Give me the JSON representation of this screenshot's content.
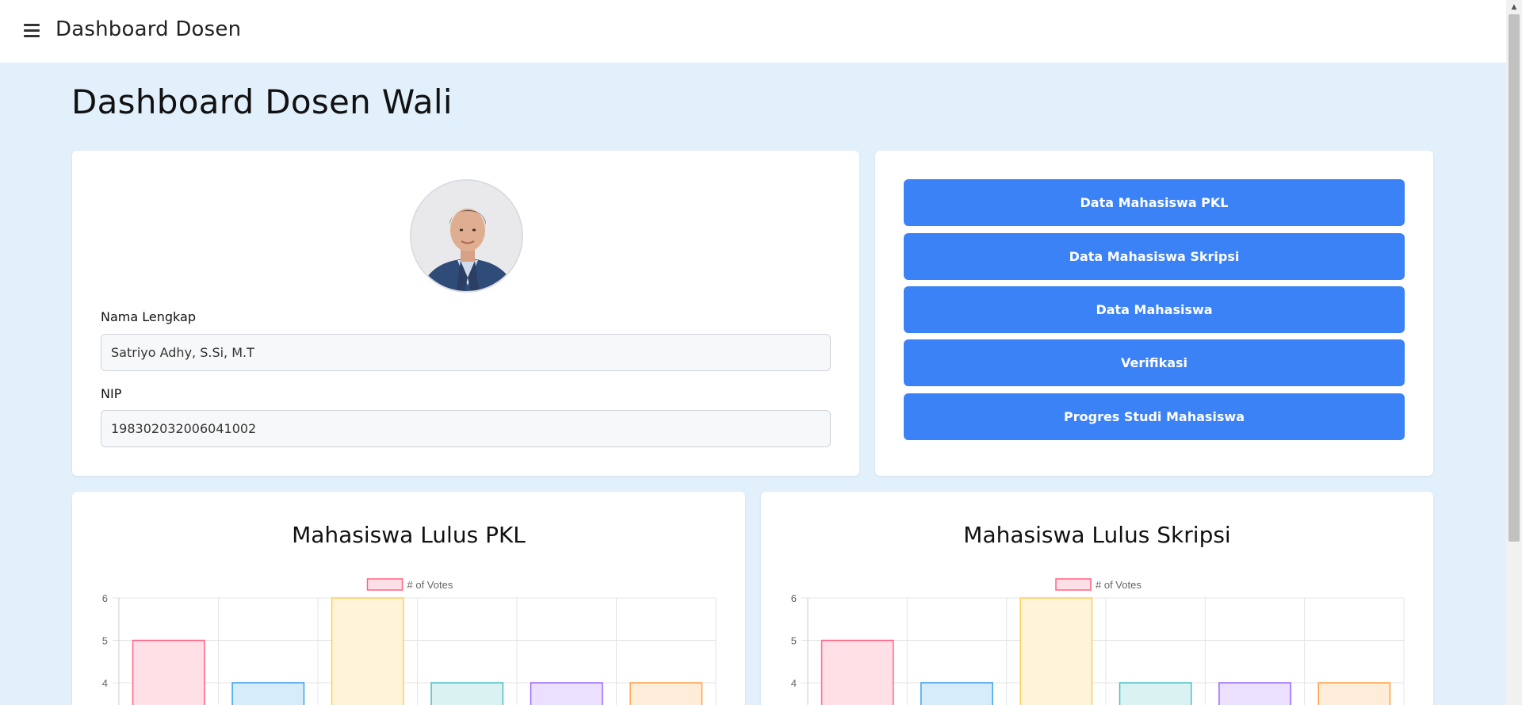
{
  "header": {
    "title": "Dashboard Dosen",
    "menu_icon": "hamburger-icon"
  },
  "page": {
    "title": "Dashboard Dosen Wali"
  },
  "profile": {
    "name_label": "Nama Lengkap",
    "name_value": "Satriyo Adhy, S.Si, M.T",
    "nip_label": "NIP",
    "nip_value": "198302032006041002"
  },
  "actions": [
    {
      "label": "Data Mahasiswa PKL"
    },
    {
      "label": "Data Mahasiswa Skripsi"
    },
    {
      "label": "Data Mahasiswa"
    },
    {
      "label": "Verifikasi"
    },
    {
      "label": "Progres Studi Mahasiswa"
    }
  ],
  "colors": {
    "accent": "#3b82f6",
    "page_bg": "#e2f0fb"
  },
  "chart_data": [
    {
      "type": "bar",
      "title": "Mahasiswa Lulus PKL",
      "legend_position": "top",
      "grid": true,
      "ylim_visible": [
        4,
        6
      ],
      "y_ticks": [
        6,
        5,
        4
      ],
      "series": [
        {
          "name": "# of Votes",
          "values": [
            5,
            4,
            6,
            4,
            4,
            4
          ]
        }
      ],
      "bar_colors": [
        {
          "fill": "#ffe0e6",
          "stroke": "#ff6384"
        },
        {
          "fill": "#d7ecfb",
          "stroke": "#36a2eb"
        },
        {
          "fill": "#fff3d9",
          "stroke": "#ffcd56"
        },
        {
          "fill": "#dbf2f2",
          "stroke": "#4bc0c0"
        },
        {
          "fill": "#ebe0ff",
          "stroke": "#9966ff"
        },
        {
          "fill": "#ffecd9",
          "stroke": "#ff9f40"
        }
      ]
    },
    {
      "type": "bar",
      "title": "Mahasiswa Lulus Skripsi",
      "legend_position": "top",
      "grid": true,
      "ylim_visible": [
        4,
        6
      ],
      "y_ticks": [
        6,
        5,
        4
      ],
      "series": [
        {
          "name": "# of Votes",
          "values": [
            5,
            4,
            6,
            4,
            4,
            4
          ]
        }
      ],
      "bar_colors": [
        {
          "fill": "#ffe0e6",
          "stroke": "#ff6384"
        },
        {
          "fill": "#d7ecfb",
          "stroke": "#36a2eb"
        },
        {
          "fill": "#fff3d9",
          "stroke": "#ffcd56"
        },
        {
          "fill": "#dbf2f2",
          "stroke": "#4bc0c0"
        },
        {
          "fill": "#ebe0ff",
          "stroke": "#9966ff"
        },
        {
          "fill": "#ffecd9",
          "stroke": "#ff9f40"
        }
      ]
    }
  ]
}
